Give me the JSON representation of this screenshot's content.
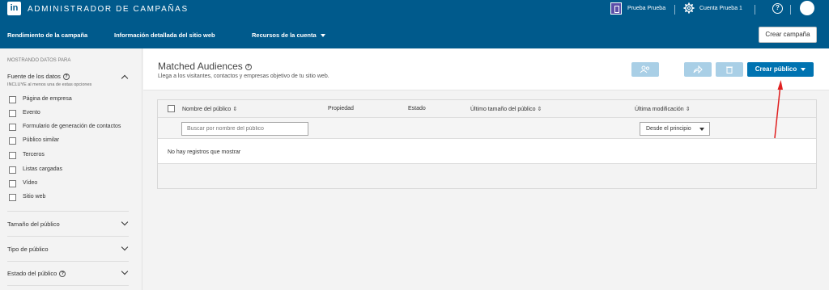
{
  "topbar": {
    "logo_text": "in",
    "app_title": "Administrador de campañas",
    "account_name": "Prueba Prueba",
    "account_menu": "Cuenta Prueba 1",
    "help_icon": "?"
  },
  "nav": {
    "items": [
      "Rendimiento de la campaña",
      "Información detallada del sitio web",
      "Recursos de la cuenta"
    ],
    "create_campaign": "Crear campaña"
  },
  "sidebar": {
    "showing_label": "Mostrando datos para",
    "data_source_title": "Fuente de los datos",
    "data_source_sub": "INCLUYE al menos una de estas opciones",
    "options": [
      "Página de empresa",
      "Evento",
      "Formulario de generación de contactos",
      "Público similar",
      "Terceros",
      "Listas cargadas",
      "Vídeo",
      "Sitio web"
    ],
    "sections": [
      "Tamaño del público",
      "Tipo de público",
      "Estado del público"
    ]
  },
  "main": {
    "title": "Matched Audiences",
    "subtitle": "Llega a los visitantes, contactos y empresas objetivo de tu sitio web.",
    "create_public": "Crear público"
  },
  "table": {
    "columns": [
      "Nombre del público",
      "Propiedad",
      "Estado",
      "Último tamaño del público",
      "Última modificación"
    ],
    "search_placeholder": "Buscar por nombre del público",
    "date_filter": "Desde el principio",
    "empty_message": "No hay registros que mostrar"
  },
  "colors": {
    "brand": "#005a8c",
    "primary_button": "#0073b1",
    "disabled_button": "#a9cfe6",
    "annotation_arrow": "#e02020"
  }
}
